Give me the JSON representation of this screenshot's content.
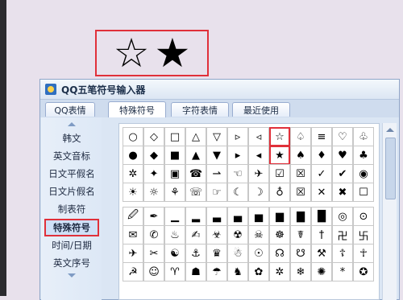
{
  "preview": {
    "star_outline": "☆",
    "star_filled": "★"
  },
  "window": {
    "title": "QQ五笔符号输入器"
  },
  "tabs": [
    {
      "label": "QQ表情"
    },
    {
      "label": "特殊符号"
    },
    {
      "label": "字符表情"
    },
    {
      "label": "最近使用"
    }
  ],
  "sidebar": {
    "items": [
      {
        "label": "韩文"
      },
      {
        "label": "英文音标"
      },
      {
        "label": "日文平假名"
      },
      {
        "label": "日文片假名"
      },
      {
        "label": "制表符"
      },
      {
        "label": "特殊符号"
      },
      {
        "label": "时间/日期"
      },
      {
        "label": "英文序号"
      }
    ]
  },
  "grid_top": [
    [
      "○",
      "◇",
      "□",
      "△",
      "▽",
      "▹",
      "◃",
      "☆",
      "♤",
      "≡",
      "♡",
      "♧"
    ],
    [
      "●",
      "◆",
      "■",
      "▲",
      "▼",
      "▸",
      "◂",
      "★",
      "♠",
      "♦",
      "♥",
      "♣"
    ],
    [
      "✲",
      "✦",
      "▣",
      "☎",
      "⇀",
      "☜",
      "✈",
      "☑",
      "☒",
      "✓",
      "✔",
      "◉"
    ],
    [
      "☀",
      "☼",
      "⚘",
      "☏",
      "☞",
      "☾",
      "☽",
      "♁",
      "☒",
      "✕",
      "✖",
      "☐"
    ]
  ],
  "grid_bottom": [
    [
      "🖉",
      "✒",
      "▁",
      "▂",
      "▃",
      "▄",
      "▅",
      "▆",
      "▇",
      "█",
      "◎",
      "⊙"
    ],
    [
      "✉",
      "✆",
      "♨",
      "✍",
      "☣",
      "☢",
      "☠",
      "☸",
      "☤",
      "†",
      "卍",
      "卐"
    ],
    [
      "✈",
      "✂",
      "☯",
      "⚓",
      "♛",
      "☃",
      "☉",
      "☊",
      "☋",
      "⚒",
      "☦",
      "☥"
    ],
    [
      "☭",
      "☺",
      "♈",
      "☗",
      "☂",
      "♞",
      "✿",
      "✲",
      "❄",
      "✺",
      "*",
      "✪"
    ]
  ]
}
